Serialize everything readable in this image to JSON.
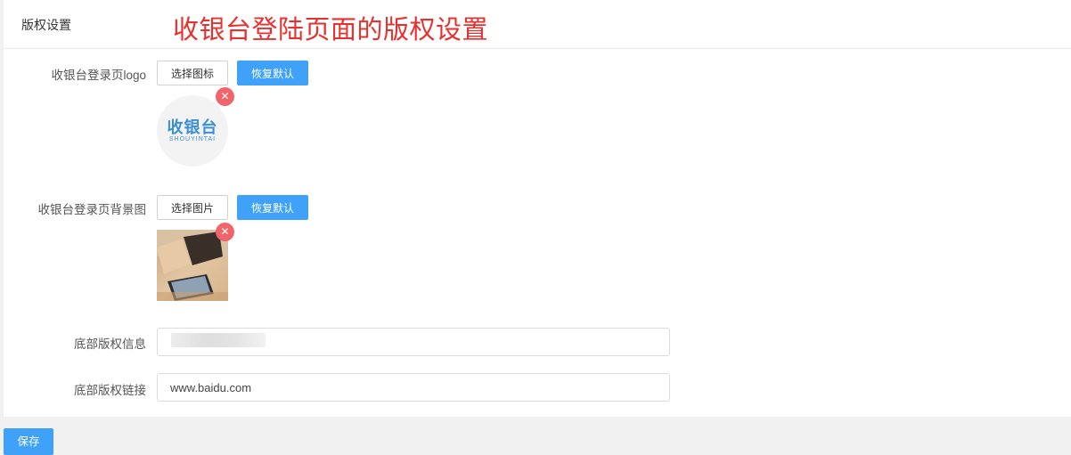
{
  "panel": {
    "title": "版权设置",
    "annotation": "收银台登陆页面的版权设置"
  },
  "logo_field": {
    "label": "收银台登录页logo",
    "select_button": "选择图标",
    "reset_button": "恢复默认",
    "logo_text_cn": "收银台",
    "logo_text_en": "SHOUYINTAI",
    "remove_icon": "close-icon"
  },
  "background_field": {
    "label": "收银台登录页背景图",
    "select_button": "选择图片",
    "reset_button": "恢复默认",
    "remove_icon": "close-icon"
  },
  "copyright_info": {
    "label": "底部版权信息",
    "value": ""
  },
  "copyright_link": {
    "label": "底部版权链接",
    "value": "www.baidu.com"
  },
  "save_button": "保存",
  "colors": {
    "primary": "#3fa2f8",
    "annotation": "#e8312e",
    "remove_badge": "#f0656b"
  }
}
